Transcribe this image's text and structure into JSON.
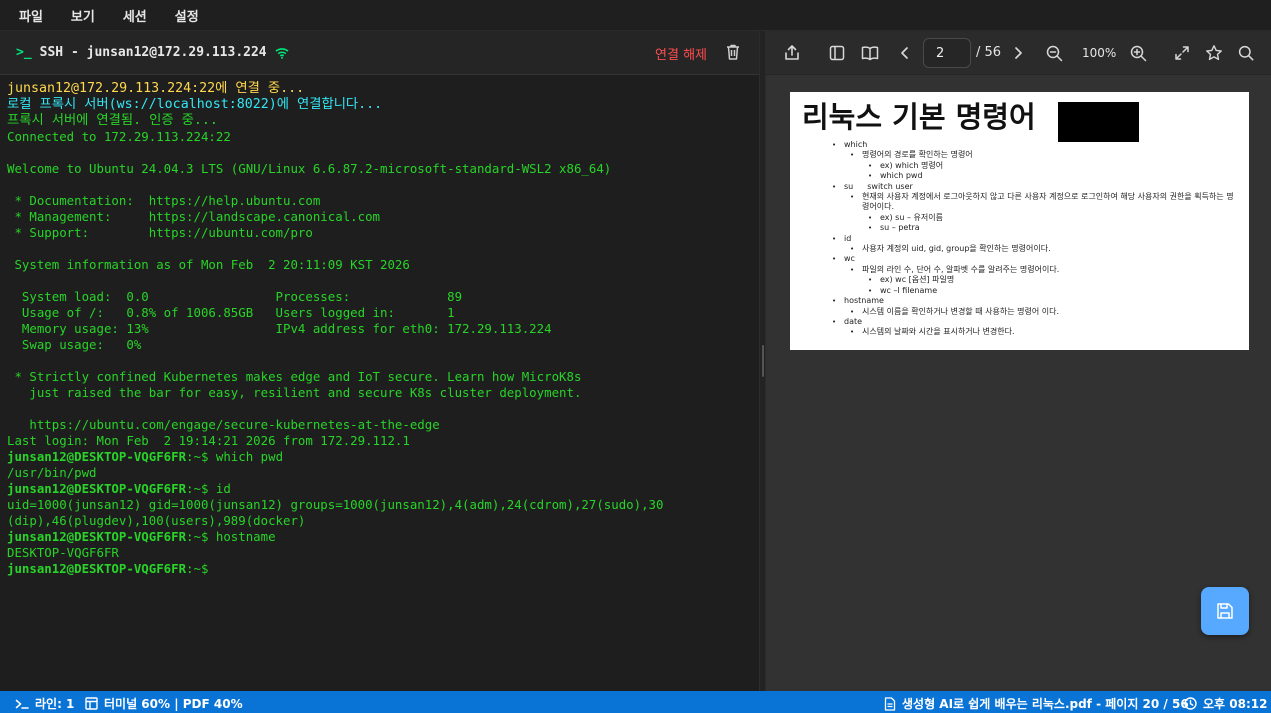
{
  "menu": [
    "파일",
    "보기",
    "세션",
    "설정"
  ],
  "terminal": {
    "prompt_icon": ">_",
    "title": "SSH - junsan12@172.29.113.224",
    "disconnect_label": "연결 해제",
    "lines": [
      {
        "text": "junsan12@172.29.113.224:22에 연결 중...",
        "style": "yellow"
      },
      {
        "text": "로컬 프록시 서버(ws://localhost:8022)에 연결합니다...",
        "style": "cyan"
      },
      {
        "text": "프록시 서버에 연결됨. 인증 중...",
        "style": "green-kr"
      },
      {
        "text": "Connected to 172.29.113.224:22",
        "style": "green"
      },
      {
        "text": "",
        "style": "green"
      },
      {
        "text": "Welcome to Ubuntu 24.04.3 LTS (GNU/Linux 6.6.87.2-microsoft-standard-WSL2 x86_64)",
        "style": "green"
      },
      {
        "text": "",
        "style": "green"
      },
      {
        "text": " * Documentation:  https://help.ubuntu.com",
        "style": "green"
      },
      {
        "text": " * Management:     https://landscape.canonical.com",
        "style": "green"
      },
      {
        "text": " * Support:        https://ubuntu.com/pro",
        "style": "green"
      },
      {
        "text": "",
        "style": "green"
      },
      {
        "text": " System information as of Mon Feb  2 20:11:09 KST 2026",
        "style": "green"
      },
      {
        "text": "",
        "style": "green"
      },
      {
        "text": "  System load:  0.0                 Processes:             89",
        "style": "green"
      },
      {
        "text": "  Usage of /:   0.8% of 1006.85GB   Users logged in:       1",
        "style": "green"
      },
      {
        "text": "  Memory usage: 13%                 IPv4 address for eth0: 172.29.113.224",
        "style": "green"
      },
      {
        "text": "  Swap usage:   0%",
        "style": "green"
      },
      {
        "text": "",
        "style": "green"
      },
      {
        "text": " * Strictly confined Kubernetes makes edge and IoT secure. Learn how MicroK8s",
        "style": "green"
      },
      {
        "text": "   just raised the bar for easy, resilient and secure K8s cluster deployment.",
        "style": "green"
      },
      {
        "text": "",
        "style": "green"
      },
      {
        "text": "   https://ubuntu.com/engage/secure-kubernetes-at-the-edge",
        "style": "green"
      },
      {
        "text": "Last login: Mon Feb  2 19:14:21 2026 from 172.29.112.1",
        "style": "green"
      },
      {
        "prompt": "junsan12@DESKTOP-VQGF6FR",
        "cmd": ":~$ which pwd",
        "style": "prompt"
      },
      {
        "text": "/usr/bin/pwd",
        "style": "green"
      },
      {
        "prompt": "junsan12@DESKTOP-VQGF6FR",
        "cmd": ":~$ id",
        "style": "prompt"
      },
      {
        "text": "uid=1000(junsan12) gid=1000(junsan12) groups=1000(junsan12),4(adm),24(cdrom),27(sudo),30",
        "style": "green"
      },
      {
        "text": "(dip),46(plugdev),100(users),989(docker)",
        "style": "green"
      },
      {
        "prompt": "junsan12@DESKTOP-VQGF6FR",
        "cmd": ":~$ hostname",
        "style": "prompt"
      },
      {
        "text": "DESKTOP-VQGF6FR",
        "style": "green"
      },
      {
        "prompt": "junsan12@DESKTOP-VQGF6FR",
        "cmd": ":~$",
        "style": "prompt"
      }
    ]
  },
  "pdf": {
    "page_current": "2",
    "page_total": "/ 56",
    "zoom": "100%",
    "heading": "리눅스 기본 명령어",
    "items": [
      {
        "level": 1,
        "text": "which"
      },
      {
        "level": 2,
        "text": "명령어의 경로를 확인하는 명령어"
      },
      {
        "level": 3,
        "text": "ex) which 명령어"
      },
      {
        "level": 3,
        "text": "which pwd"
      },
      {
        "level": 1,
        "text": "su",
        "extra": "switch user"
      },
      {
        "level": 2,
        "text": "현재의 사용자 계정에서 로그아웃하지 않고 다른 사용자 계정으로 로그인하여 해당 사용자의 권한을 획득하는 명령어이다."
      },
      {
        "level": 3,
        "text": "ex) su – 유저이름"
      },
      {
        "level": 3,
        "text": "su – petra"
      },
      {
        "level": 1,
        "text": "id"
      },
      {
        "level": 2,
        "text": " 사용자 계정의 uid, gid, group을 확인하는 명령어이다."
      },
      {
        "level": 1,
        "text": "wc"
      },
      {
        "level": 2,
        "text": "파일의 라인 수, 단어 수, 알파벳 수를 알려주는 명령어이다."
      },
      {
        "level": 3,
        "text": "ex) wc [옵션] 파일명"
      },
      {
        "level": 3,
        "text": "wc –l filename"
      },
      {
        "level": 1,
        "text": "hostname"
      },
      {
        "level": 2,
        "text": "시스템 이름을 확인하거나 변경할 때 사용하는 명령어 이다."
      },
      {
        "level": 1,
        "text": "date"
      },
      {
        "level": 2,
        "text": "시스템의 날짜와 시간을 표시하거나 변경한다."
      }
    ]
  },
  "status": {
    "line": "라인: 1",
    "layout": "터미널 60% | PDF 40%",
    "file": "생성형 AI로 쉽게 배우는 리눅스.pdf - 페이지 20 / 56",
    "time": "오후 08:12"
  },
  "colors": {
    "status_bar": "#0a74d6",
    "terminal_green": "#28d428",
    "terminal_yellow": "#ffd84d",
    "terminal_cyan": "#33e6f5",
    "disconnect_red": "#ff4d4f",
    "save_button": "#57a8ff"
  }
}
